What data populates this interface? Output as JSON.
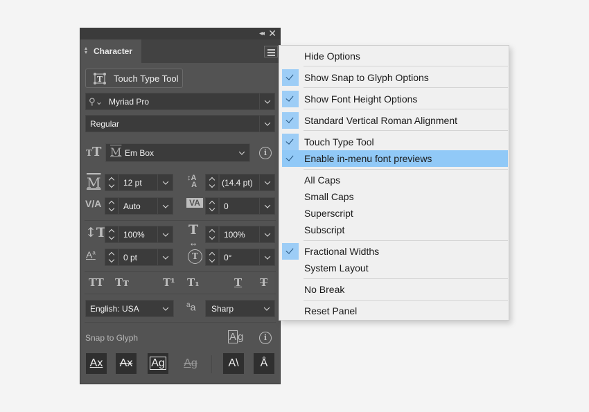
{
  "panel": {
    "tab_label": "Character",
    "touch_type_label": "Touch Type Tool",
    "font_family": "Myriad Pro",
    "font_style": "Regular",
    "em_box": "Em Box",
    "font_size": "12 pt",
    "leading": "(14.4 pt)",
    "kerning": "Auto",
    "tracking": "0",
    "vertical_scale": "100%",
    "horizontal_scale": "100%",
    "baseline_shift": "0 pt",
    "rotation": "0°",
    "language": "English: USA",
    "anti_aliasing": "Sharp",
    "snap_label": "Snap to Glyph",
    "type_buttons": [
      "TT",
      "Tт",
      "T¹",
      "T₁",
      "T",
      "T"
    ],
    "snap_buttons": [
      "Ax",
      "Ax",
      "Ag",
      "Ag",
      "A\\",
      "Å"
    ]
  },
  "menu": {
    "items": [
      {
        "label": "Hide Options",
        "checked": false
      },
      {
        "label": "Show Snap to Glyph Options",
        "checked": true
      },
      {
        "label": "Show Font Height Options",
        "checked": true
      },
      {
        "label": "Standard Vertical Roman Alignment",
        "checked": true
      },
      {
        "label": "Touch Type Tool",
        "checked": true
      },
      {
        "label": "Enable in-menu font previews",
        "checked": true,
        "highlighted": true
      },
      {
        "label": "All Caps",
        "checked": false
      },
      {
        "label": "Small Caps",
        "checked": false
      },
      {
        "label": "Superscript",
        "checked": false
      },
      {
        "label": "Subscript",
        "checked": false
      },
      {
        "label": "Fractional Widths",
        "checked": true
      },
      {
        "label": "System Layout",
        "checked": false
      },
      {
        "label": "No Break",
        "checked": false
      },
      {
        "label": "Reset Panel",
        "checked": false
      }
    ]
  },
  "colors": {
    "panel_bg": "#535353",
    "menu_bg": "#f0f0f0",
    "highlight": "#91c9f7",
    "check_bg": "#9dcdf6"
  }
}
